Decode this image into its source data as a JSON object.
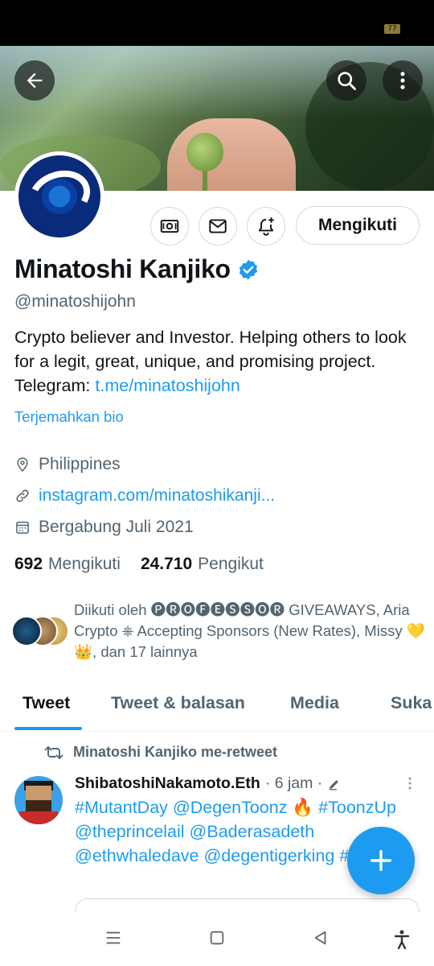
{
  "status_bar": {
    "battery": "77"
  },
  "profile": {
    "name": "Minatoshi Kanjiko",
    "handle": "@minatoshijohn",
    "bio_text": "Crypto believer and Investor. Helping others to look for a legit, great, unique, and promising project. Telegram: ",
    "bio_link": "t.me/minatoshijohn",
    "translate_bio": "Terjemahkan bio",
    "location": "Philippines",
    "website": "instagram.com/minatoshikanji...",
    "joined": "Bergabung Juli 2021",
    "following_count": "692",
    "following_label": "Mengikuti",
    "followers_count": "24.710",
    "followers_label": "Pengikut",
    "follow_button": "Mengikuti",
    "followed_by": "Diikuti oleh 🅟🅡🅞🅕🅔🅢🅢🅞🅡 GIVEAWAYS, Aria Crypto ⎈ Accepting Sponsors (New Rates), Missy 💛👑, dan 17 lainnya"
  },
  "tabs": [
    {
      "label": "Tweet"
    },
    {
      "label": "Tweet & balasan"
    },
    {
      "label": "Media"
    },
    {
      "label": "Suka"
    }
  ],
  "tweet": {
    "retweet_label": "Minatoshi Kanjiko me-retweet",
    "author": "ShibatoshiNakamoto.Eth",
    "time": "· 6 jam ·",
    "body": "#MutantDay @DegenToonz 🔥 #ToonzUp @theprincelail @Baderasadeth @ethwhaledave @degentigerking #NFT ⚡"
  },
  "colors": {
    "accent": "#1d9bf0",
    "muted": "#536471",
    "text": "#0f1419"
  },
  "icons": [
    "back-arrow-icon",
    "search-icon",
    "more-vertical-icon",
    "tip-money-icon",
    "mail-icon",
    "bell-plus-icon",
    "verified-icon",
    "location-pin-icon",
    "link-icon",
    "calendar-icon",
    "retweet-icon",
    "edit-icon",
    "plus-icon",
    "menu-icon",
    "home-square-icon",
    "back-triangle-icon",
    "accessibility-icon"
  ]
}
